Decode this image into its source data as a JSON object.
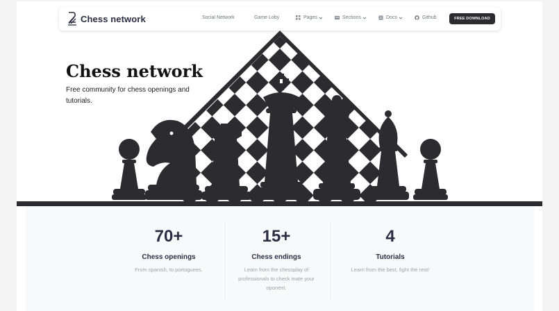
{
  "brand": {
    "name": "Chess network"
  },
  "nav": {
    "items": [
      {
        "label": "Social Network"
      },
      {
        "label": "Game Loby"
      },
      {
        "label": "Pages"
      },
      {
        "label": "Sections"
      },
      {
        "label": "Docs"
      },
      {
        "label": "Github"
      }
    ],
    "cta": "FREE DOWNLOAD"
  },
  "hero": {
    "title": "Chess network",
    "subtitle": "Free community for chess openings and tutorials."
  },
  "stats": [
    {
      "value": "70+",
      "title": "Chess openings",
      "description": "From spanish, to portoguees."
    },
    {
      "value": "15+",
      "title": "Chess endings",
      "description": "Learn from the chessplay of professionals to check mate your oponent."
    },
    {
      "value": "4",
      "title": "Tutorials",
      "description": "Learn from the best, fight the rest!"
    }
  ],
  "colors": {
    "dark": "#2b2b30",
    "heading": "#2b2d42",
    "muted": "#9aa0a8"
  }
}
